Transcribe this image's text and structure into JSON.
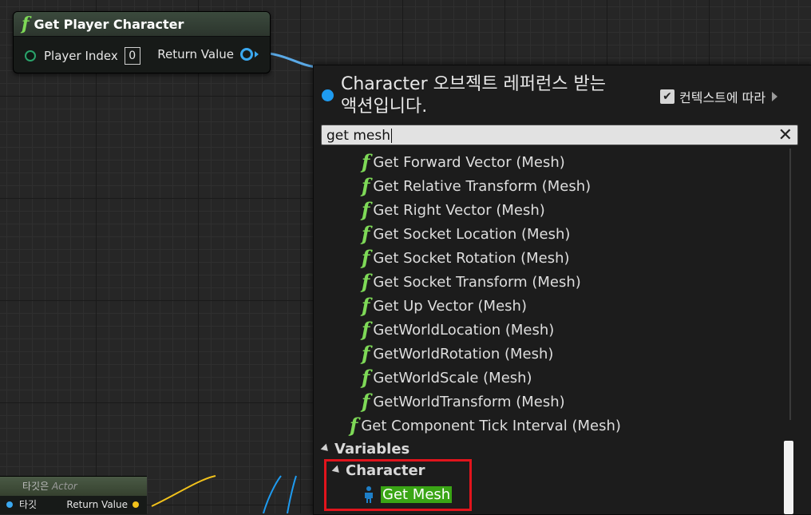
{
  "node": {
    "title": "Get Player Character",
    "input_label": "Player Index",
    "input_value": "0",
    "output_label": "Return Value"
  },
  "bottom_node": {
    "header": "타깃은",
    "header_type": "Actor",
    "input_label": "타깃",
    "output_label": "Return Value"
  },
  "menu": {
    "title_line1": "Character 오브젝트 레퍼런스 받는",
    "title_line2": "액션입니다.",
    "context_label": "컨텍스트에 따라",
    "context_checked": true,
    "search_value": "get mesh",
    "items": [
      "Get Forward Vector (Mesh)",
      "Get Relative Transform (Mesh)",
      "Get Right Vector (Mesh)",
      "Get Socket Location (Mesh)",
      "Get Socket Rotation (Mesh)",
      "Get Socket Transform (Mesh)",
      "Get Up Vector (Mesh)",
      "GetWorldLocation (Mesh)",
      "GetWorldRotation (Mesh)",
      "GetWorldScale (Mesh)",
      "GetWorldTransform (Mesh)"
    ],
    "tick_item": "Get Component Tick Interval (Mesh)",
    "category_variables": "Variables",
    "category_character": "Character",
    "selected_item": "Get Mesh"
  },
  "colors": {
    "accent_blue": "#1e9bf0",
    "function_green": "#7ed957",
    "selection_green": "#3aa515",
    "highlight_red": "#e1141c"
  }
}
